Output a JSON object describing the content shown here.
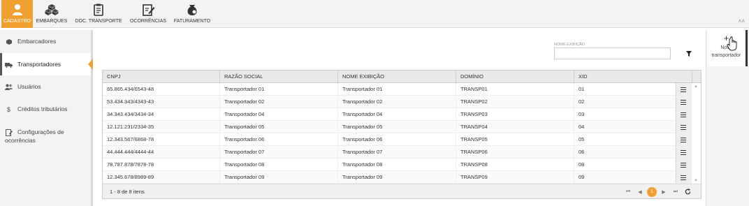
{
  "topnav": {
    "items": [
      {
        "label": "CADASTRO",
        "icon": "user-icon",
        "active": true
      },
      {
        "label": "EMBARQUES",
        "icon": "boxes-icon",
        "active": false
      },
      {
        "label": "DOC. TRANSPORTE",
        "icon": "clipboard-icon",
        "active": false
      },
      {
        "label": "OCORRÊNCIAS",
        "icon": "edit-document-icon",
        "active": false
      },
      {
        "label": "FATURAMENTO",
        "icon": "money-bag-icon",
        "active": false
      }
    ],
    "collapse_icon": "double-chevron-up-icon"
  },
  "sidebar": {
    "items": [
      {
        "label": "Embarcadores",
        "icon": "cube-icon",
        "active": false
      },
      {
        "label": "Transportadores",
        "icon": "truck-icon",
        "active": true
      },
      {
        "label": "Usuários",
        "icon": "users-icon",
        "active": false
      },
      {
        "label": "Créditos tributários",
        "icon": "dollar-icon",
        "active": false
      },
      {
        "label": "Configurações de ocorrências",
        "icon": "edit-icon",
        "active": false
      }
    ]
  },
  "filter": {
    "label": "NOME EXIBIÇÃO",
    "value": "",
    "icon": "filter-icon"
  },
  "grid": {
    "columns": [
      "CNPJ",
      "RAZÃO SOCIAL",
      "NOME EXIBIÇÃO",
      "DOMÍNIO",
      "XID"
    ],
    "rows": [
      [
        "65.865.434/6543-48",
        "Transportador 01",
        "Transportador 01",
        "TRANSP01",
        "01"
      ],
      [
        "53.434.343/4343-43",
        "Transportador 02",
        "Transportador 02",
        "TRANSP02",
        "02"
      ],
      [
        "34.343.434/3434-34",
        "Transportador 04",
        "Transportador 04",
        "TRANSP03",
        "03"
      ],
      [
        "12.121.231/2334-35",
        "Transportador 05",
        "Transportador 05",
        "TRANSP04",
        "04"
      ],
      [
        "12.343.567/6868-78",
        "Transportador 06",
        "Transportador 06",
        "TRANSP05",
        "05"
      ],
      [
        "44.444.444/4444-44",
        "Transportador 07",
        "Transportador 07",
        "TRANSP06",
        "06"
      ],
      [
        "78.787.878/7878-78",
        "Transportador 08",
        "Transportador 08",
        "TRANSP08",
        "08"
      ],
      [
        "12.345.678/8989-89",
        "Transportador 09",
        "Transportador 09",
        "TRANSP09",
        "09"
      ]
    ],
    "row_menu_icon": "hamburger-menu-icon",
    "footer_info": "1 - 8 de 8 itens",
    "pager": {
      "first": "⏮",
      "prev": "◀",
      "current_page": "1",
      "next": "▶",
      "last": "⏭",
      "refresh_icon": "refresh-icon"
    }
  },
  "actions": {
    "new_label": "Novo transportador",
    "new_icon": "plus-icon"
  },
  "colors": {
    "accent": "#f0a030",
    "panel_bg": "#f3f3f3",
    "header_bg": "#e9e9e9"
  }
}
